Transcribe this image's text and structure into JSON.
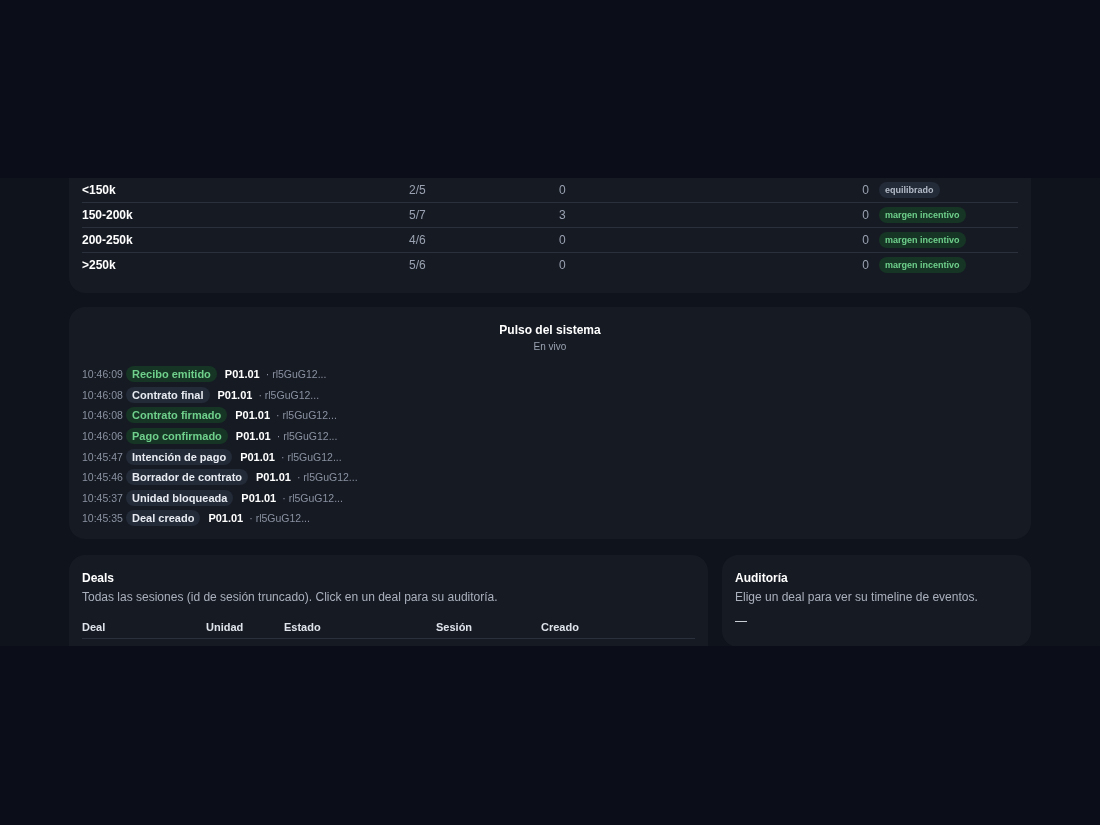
{
  "tiers": {
    "rows": [
      {
        "range": "<150k",
        "ratio": "2/5",
        "count_a": "0",
        "count_b": "0",
        "badge": {
          "label": "equilibrado",
          "kind": "neutral"
        }
      },
      {
        "range": "150-200k",
        "ratio": "5/7",
        "count_a": "3",
        "count_b": "0",
        "badge": {
          "label": "margen incentivo",
          "kind": "success"
        }
      },
      {
        "range": "200-250k",
        "ratio": "4/6",
        "count_a": "0",
        "count_b": "0",
        "badge": {
          "label": "margen incentivo",
          "kind": "success"
        }
      },
      {
        "range": ">250k",
        "ratio": "5/6",
        "count_a": "0",
        "count_b": "0",
        "badge": {
          "label": "margen incentivo",
          "kind": "success"
        }
      }
    ]
  },
  "pulse": {
    "title": "Pulso del sistema",
    "subtitle": "En vivo",
    "events": [
      {
        "time": "10:46:09",
        "event": "Recibo emitido",
        "kind": "success",
        "unit": "P01.01",
        "session": "· rl5GuG12..."
      },
      {
        "time": "10:46:08",
        "event": "Contrato final",
        "kind": "neutral",
        "unit": "P01.01",
        "session": "· rl5GuG12..."
      },
      {
        "time": "10:46:08",
        "event": "Contrato firmado",
        "kind": "success",
        "unit": "P01.01",
        "session": "· rl5GuG12..."
      },
      {
        "time": "10:46:06",
        "event": "Pago confirmado",
        "kind": "success",
        "unit": "P01.01",
        "session": "· rl5GuG12..."
      },
      {
        "time": "10:45:47",
        "event": "Intención de pago",
        "kind": "neutral",
        "unit": "P01.01",
        "session": "· rl5GuG12..."
      },
      {
        "time": "10:45:46",
        "event": "Borrador de contrato",
        "kind": "neutral",
        "unit": "P01.01",
        "session": "· rl5GuG12..."
      },
      {
        "time": "10:45:37",
        "event": "Unidad bloqueada",
        "kind": "neutral",
        "unit": "P01.01",
        "session": "· rl5GuG12..."
      },
      {
        "time": "10:45:35",
        "event": "Deal creado",
        "kind": "neutral",
        "unit": "P01.01",
        "session": "· rl5GuG12..."
      }
    ]
  },
  "deals": {
    "title": "Deals",
    "subtitle": "Todas las sesiones (id de sesión truncado). Click en un deal para su auditoría.",
    "columns": [
      "Deal",
      "Unidad",
      "Estado",
      "Sesión",
      "Creado"
    ]
  },
  "audit": {
    "title": "Auditoría",
    "subtitle": "Elige un deal para ver su timeline de eventos.",
    "empty": "—"
  }
}
